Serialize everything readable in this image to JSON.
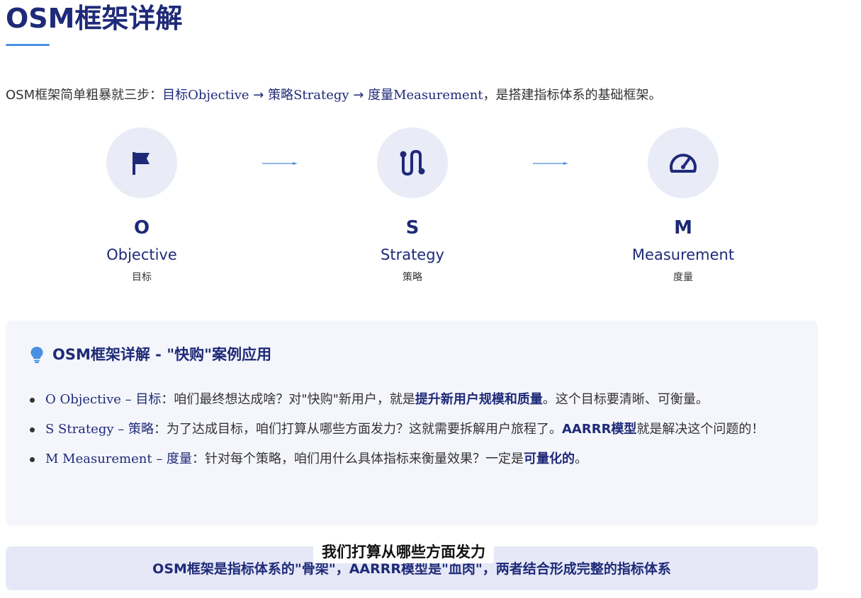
{
  "page_title": "OSM框架详解",
  "intro": {
    "prefix": "OSM框架简单粗暴就三步：",
    "o_cn": "目标",
    "o_en": "Objective",
    "arrow1": " → ",
    "s_cn": "策略",
    "s_en": "Strategy",
    "arrow2": " → ",
    "m_cn": "度量",
    "m_en": "Measurement",
    "suffix": "，是搭建指标体系的基础框架。"
  },
  "steps": [
    {
      "letter": "O",
      "name": "Objective",
      "cn": "目标",
      "icon": "flag-icon"
    },
    {
      "letter": "S",
      "name": "Strategy",
      "cn": "策略",
      "icon": "route-icon"
    },
    {
      "letter": "M",
      "name": "Measurement",
      "cn": "度量",
      "icon": "gauge-icon"
    }
  ],
  "card": {
    "title": "OSM框架详解 - \"快购\"案例应用",
    "icon": "lightbulb-icon",
    "bullets": [
      {
        "lead": "O Objective – 目标",
        "text_before": "：咱们最终想达成啥？对\"快购\"新用户，就是",
        "bold": "提升新用户规模和质量",
        "text_after": "。这个目标要清晰、可衡量。"
      },
      {
        "lead": "S Strategy – 策略",
        "text_before": "：为了达成目标，咱们打算从哪些方面发力？这就需要拆解用户旅程了。",
        "bold": "AARRR模型",
        "text_after": "就是解决这个问题的！"
      },
      {
        "lead": "M Measurement – 度量",
        "text_before": "：针对每个策略，咱们用什么具体指标来衡量效果？一定是",
        "bold": "可量化的",
        "text_after": "。"
      }
    ]
  },
  "summary": "OSM框架是指标体系的\"骨架\"，AARRR模型是\"血肉\"，两者结合形成完整的指标体系",
  "caption": "我们打算从哪些方面发力",
  "colors": {
    "accent": "#1e2a78",
    "underline": "#4a90e2",
    "circle_bg": "#e9ebf7",
    "card_bg": "#f5f6fb",
    "summary_bg": "#e6e8f7"
  }
}
